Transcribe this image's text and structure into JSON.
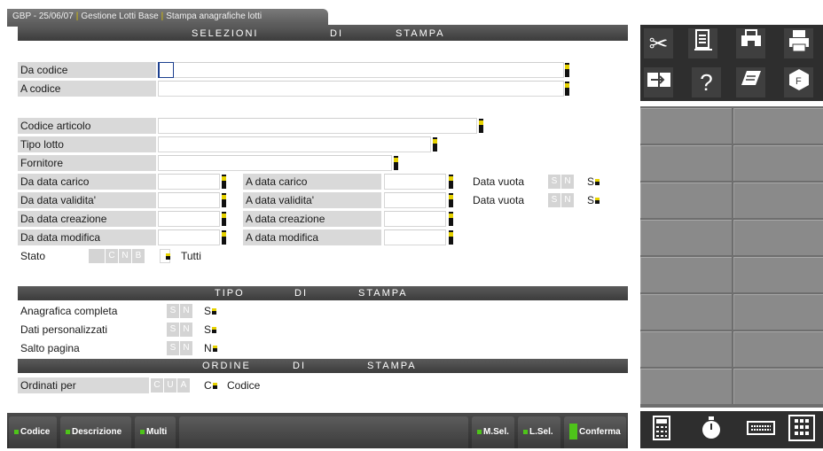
{
  "title_tab": {
    "part1": "GBP - 25/06/07",
    "part2": "Gestione Lotti Base",
    "part3": "Stampa anagrafiche lotti"
  },
  "sections": {
    "selezioni": [
      "SELEZIONI",
      "DI",
      "STAMPA"
    ],
    "tipo": [
      "TIPO",
      "DI",
      "STAMPA"
    ],
    "ordine": [
      "ORDINE",
      "DI",
      "STAMPA"
    ]
  },
  "fields": {
    "da_codice": "Da codice",
    "a_codice": "A codice",
    "codice_articolo": "Codice articolo",
    "tipo_lotto": "Tipo lotto",
    "fornitore": "Fornitore",
    "da_data_carico": "Da data carico",
    "a_data_carico": "A data carico",
    "da_data_validita": "Da data validita'",
    "a_data_validita": "A data validita'",
    "da_data_creazione": "Da data creazione",
    "a_data_creazione": "A data creazione",
    "da_data_modifica": "Da data modifica",
    "a_data_modifica": "A data modifica",
    "data_vuota_1": "Data vuota",
    "data_vuota_2": "Data vuota",
    "stato": "Stato"
  },
  "options": {
    "sn": [
      "S",
      "N"
    ],
    "stato_opts": [
      "",
      "C",
      "N",
      "B"
    ],
    "ordine_opts": [
      "C",
      "U",
      "A"
    ]
  },
  "values": {
    "data_vuota_1": "S",
    "data_vuota_2": "S",
    "stato_text": "Tutti",
    "anagrafica_completa": "S",
    "dati_personalizzati": "S",
    "salto_pagina": "N",
    "ordinati_per": "C",
    "ordinati_per_text": "Codice"
  },
  "tipo_stampa": {
    "anagrafica_completa": "Anagrafica completa",
    "dati_personalizzati": "Dati personalizzati",
    "salto_pagina": "Salto pagina"
  },
  "ordine_stampa": {
    "ordinati_per": "Ordinati per"
  },
  "bottom_buttons": {
    "codice": "Codice",
    "descrizione": "Descrizione",
    "multi": "Multi",
    "msel": "M.Sel.",
    "lsel": "L.Sel.",
    "conferma": "Conferma"
  },
  "icons": {
    "scissors": "✂",
    "help": "?",
    "colors": {
      "accent_yellow": "#e6d200",
      "led_green": "#4ec41a",
      "section_bar": "#4a4a4a"
    }
  }
}
